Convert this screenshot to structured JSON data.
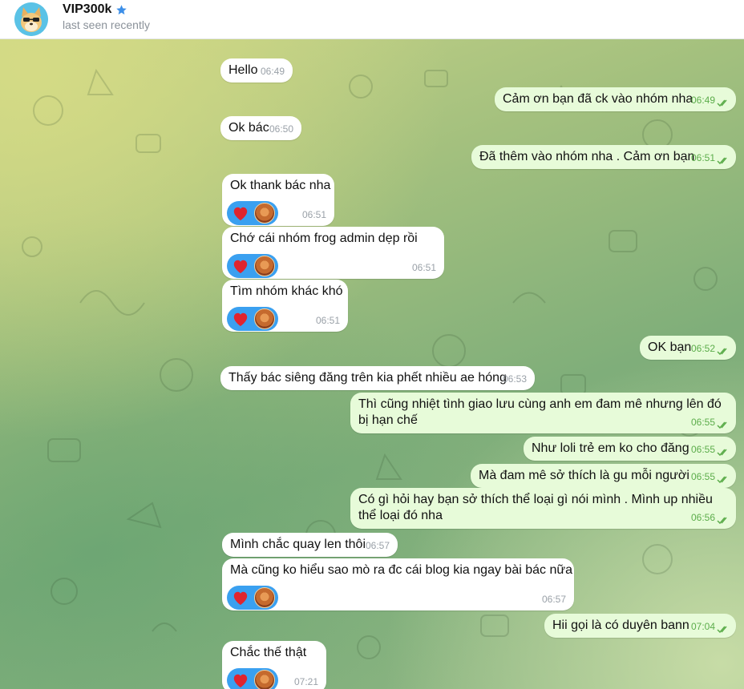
{
  "header": {
    "title": "VIP300k",
    "status": "last seen recently"
  },
  "messages": [
    {
      "side": "in",
      "text": "Hello",
      "time": "06:49"
    },
    {
      "side": "out",
      "text": "Cảm ơn bạn đã ck vào nhóm nha",
      "time": "06:49"
    },
    {
      "side": "in",
      "text": "Ok bác",
      "time": "06:50"
    },
    {
      "side": "out",
      "text": "Đã thêm vào nhóm nha . Cảm ơn bạn",
      "time": "06:51"
    },
    {
      "side": "in",
      "text": "Ok thank bác nha",
      "time": "06:51",
      "reaction": "heart"
    },
    {
      "side": "in",
      "text": "Chớ cái nhóm frog admin dẹp rồi",
      "time": "06:51",
      "reaction": "heart"
    },
    {
      "side": "in",
      "text": "Tìm nhóm khác khó",
      "time": "06:51",
      "reaction": "heart"
    },
    {
      "side": "out",
      "text": "OK bạn",
      "time": "06:52"
    },
    {
      "side": "in",
      "text": "Thấy bác siêng đăng trên kia phết nhiều ae hóng",
      "time": "06:53"
    },
    {
      "side": "out",
      "text": "Thì cũng nhiệt tình giao lưu cùng anh em đam mê nhưng lên đó bị hạn chế",
      "time": "06:55"
    },
    {
      "side": "out",
      "text": "Như loli trẻ em ko cho đăng",
      "time": "06:55"
    },
    {
      "side": "out",
      "text": "Mà đam mê sở thích là gu mỗi người",
      "time": "06:55"
    },
    {
      "side": "out",
      "text": "Có gì hỏi hay bạn sở thích thể loại gì nói mình . Mình up nhiều thể loại đó nha",
      "time": "06:56"
    },
    {
      "side": "in",
      "text": "Mình chắc quay len thôi",
      "time": "06:57"
    },
    {
      "side": "in",
      "text": "Mà cũng ko hiểu sao mò ra đc cái blog kia ngay bài bác nữa",
      "time": "06:57",
      "reaction": "heart"
    },
    {
      "side": "out",
      "text": "Hii gọi là có duyên bann",
      "time": "07:04"
    },
    {
      "side": "in",
      "text": "Chắc thế thật",
      "time": "07:21",
      "reaction": "heart"
    }
  ]
}
